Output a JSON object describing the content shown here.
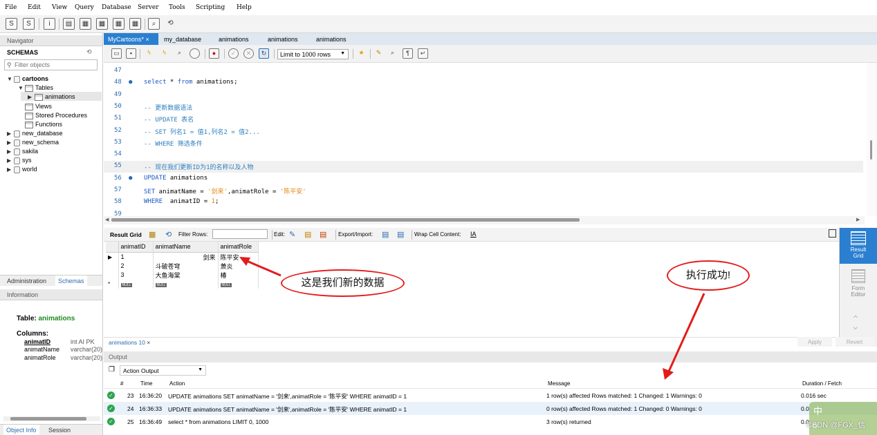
{
  "menu": [
    "File",
    "Edit",
    "View",
    "Query",
    "Database",
    "Server",
    "Tools",
    "Scripting",
    "Help"
  ],
  "navigator": {
    "title": "Navigator",
    "schemas_label": "SCHEMAS",
    "filter_placeholder": "Filter objects",
    "tree": {
      "db": "cartoons",
      "tables": "Tables",
      "table": "animations",
      "views": "Views",
      "procs": "Stored Procedures",
      "funcs": "Functions",
      "others": [
        "new_database",
        "new_schema",
        "sakila",
        "sys",
        "world"
      ]
    },
    "bottom_tabs": [
      "Administration",
      "Schemas"
    ]
  },
  "information": {
    "title": "Information",
    "table_label": "Table:",
    "table_name": "animations",
    "columns_label": "Columns:",
    "columns": [
      {
        "name": "animatID",
        "type": "int AI PK"
      },
      {
        "name": "animatName",
        "type": "varchar(20)"
      },
      {
        "name": "animatRole",
        "type": "varchar(20)"
      }
    ],
    "bottom_tabs": [
      "Object Info",
      "Session"
    ]
  },
  "editor": {
    "tabs": [
      "MyCartoons*",
      "my_database",
      "animations",
      "animations",
      "animations"
    ],
    "limit": "Limit to 1000 rows",
    "lines": [
      {
        "n": "47",
        "text": ""
      },
      {
        "n": "48",
        "text": "select * from animations;"
      },
      {
        "n": "49",
        "text": ""
      },
      {
        "n": "50",
        "text": "-- 更新数据语法"
      },
      {
        "n": "51",
        "text": "-- UPDATE 表名"
      },
      {
        "n": "52",
        "text": "-- SET 列名1 = 值1,列名2 = 值2..."
      },
      {
        "n": "53",
        "text": "-- WHERE 筛选条件"
      },
      {
        "n": "54",
        "text": ""
      },
      {
        "n": "55",
        "text": "-- 现在我们更新ID为1的名称以及人物"
      },
      {
        "n": "56",
        "text": "UPDATE animations"
      },
      {
        "n": "57",
        "text": "SET animatName = '剑来',animatRole = '陈平安'"
      },
      {
        "n": "58",
        "text": "WHERE  animatID = 1;"
      },
      {
        "n": "59",
        "text": ""
      }
    ]
  },
  "result": {
    "label": "Result Grid",
    "filter_label": "Filter Rows:",
    "edit_label": "Edit:",
    "export_label": "Export/Import:",
    "wrap_label": "Wrap Cell Content:",
    "columns": [
      "animatID",
      "animatName",
      "animatRole"
    ],
    "rows": [
      [
        "1",
        "剑来",
        "陈平安"
      ],
      [
        "2",
        "斗破苍穹",
        "萧炎"
      ],
      [
        "3",
        "大鱼海棠",
        "椿"
      ]
    ],
    "null_label": "NULL",
    "tab": "animations 10",
    "side": [
      "Result Grid",
      "Form Editor"
    ],
    "apply": "Apply",
    "revert": "Revert"
  },
  "output": {
    "title": "Output",
    "selector": "Action Output",
    "headers": [
      "#",
      "Time",
      "Action",
      "Message",
      "Duration / Fetch"
    ],
    "rows": [
      {
        "num": "23",
        "time": "16:36:20",
        "action": "UPDATE animations SET animatName = '剑来',animatRole = '陈平安' WHERE  animatID = 1",
        "message": "1 row(s) affected Rows matched: 1  Changed: 1  Warnings: 0",
        "dur": "0.016 sec"
      },
      {
        "num": "24",
        "time": "16:36:33",
        "action": "UPDATE animations SET animatName = '剑来',animatRole = '陈平安' WHERE  animatID = 1",
        "message": "0 row(s) affected Rows matched: 1  Changed: 0  Warnings: 0",
        "dur": "0.0"
      },
      {
        "num": "25",
        "time": "16:36:49",
        "action": "select * from animations LIMIT 0, 1000",
        "message": "3 row(s) returned",
        "dur": "0.0"
      }
    ]
  },
  "annotations": {
    "new_data": "这是我们新的数据",
    "success": "执行成功!"
  },
  "watermark": "CSDN @FGX_信",
  "ime": "中",
  "colors": {
    "tab_active": "#2b7fd0",
    "annot": "#e31b1b",
    "ok": "#2da44e"
  }
}
